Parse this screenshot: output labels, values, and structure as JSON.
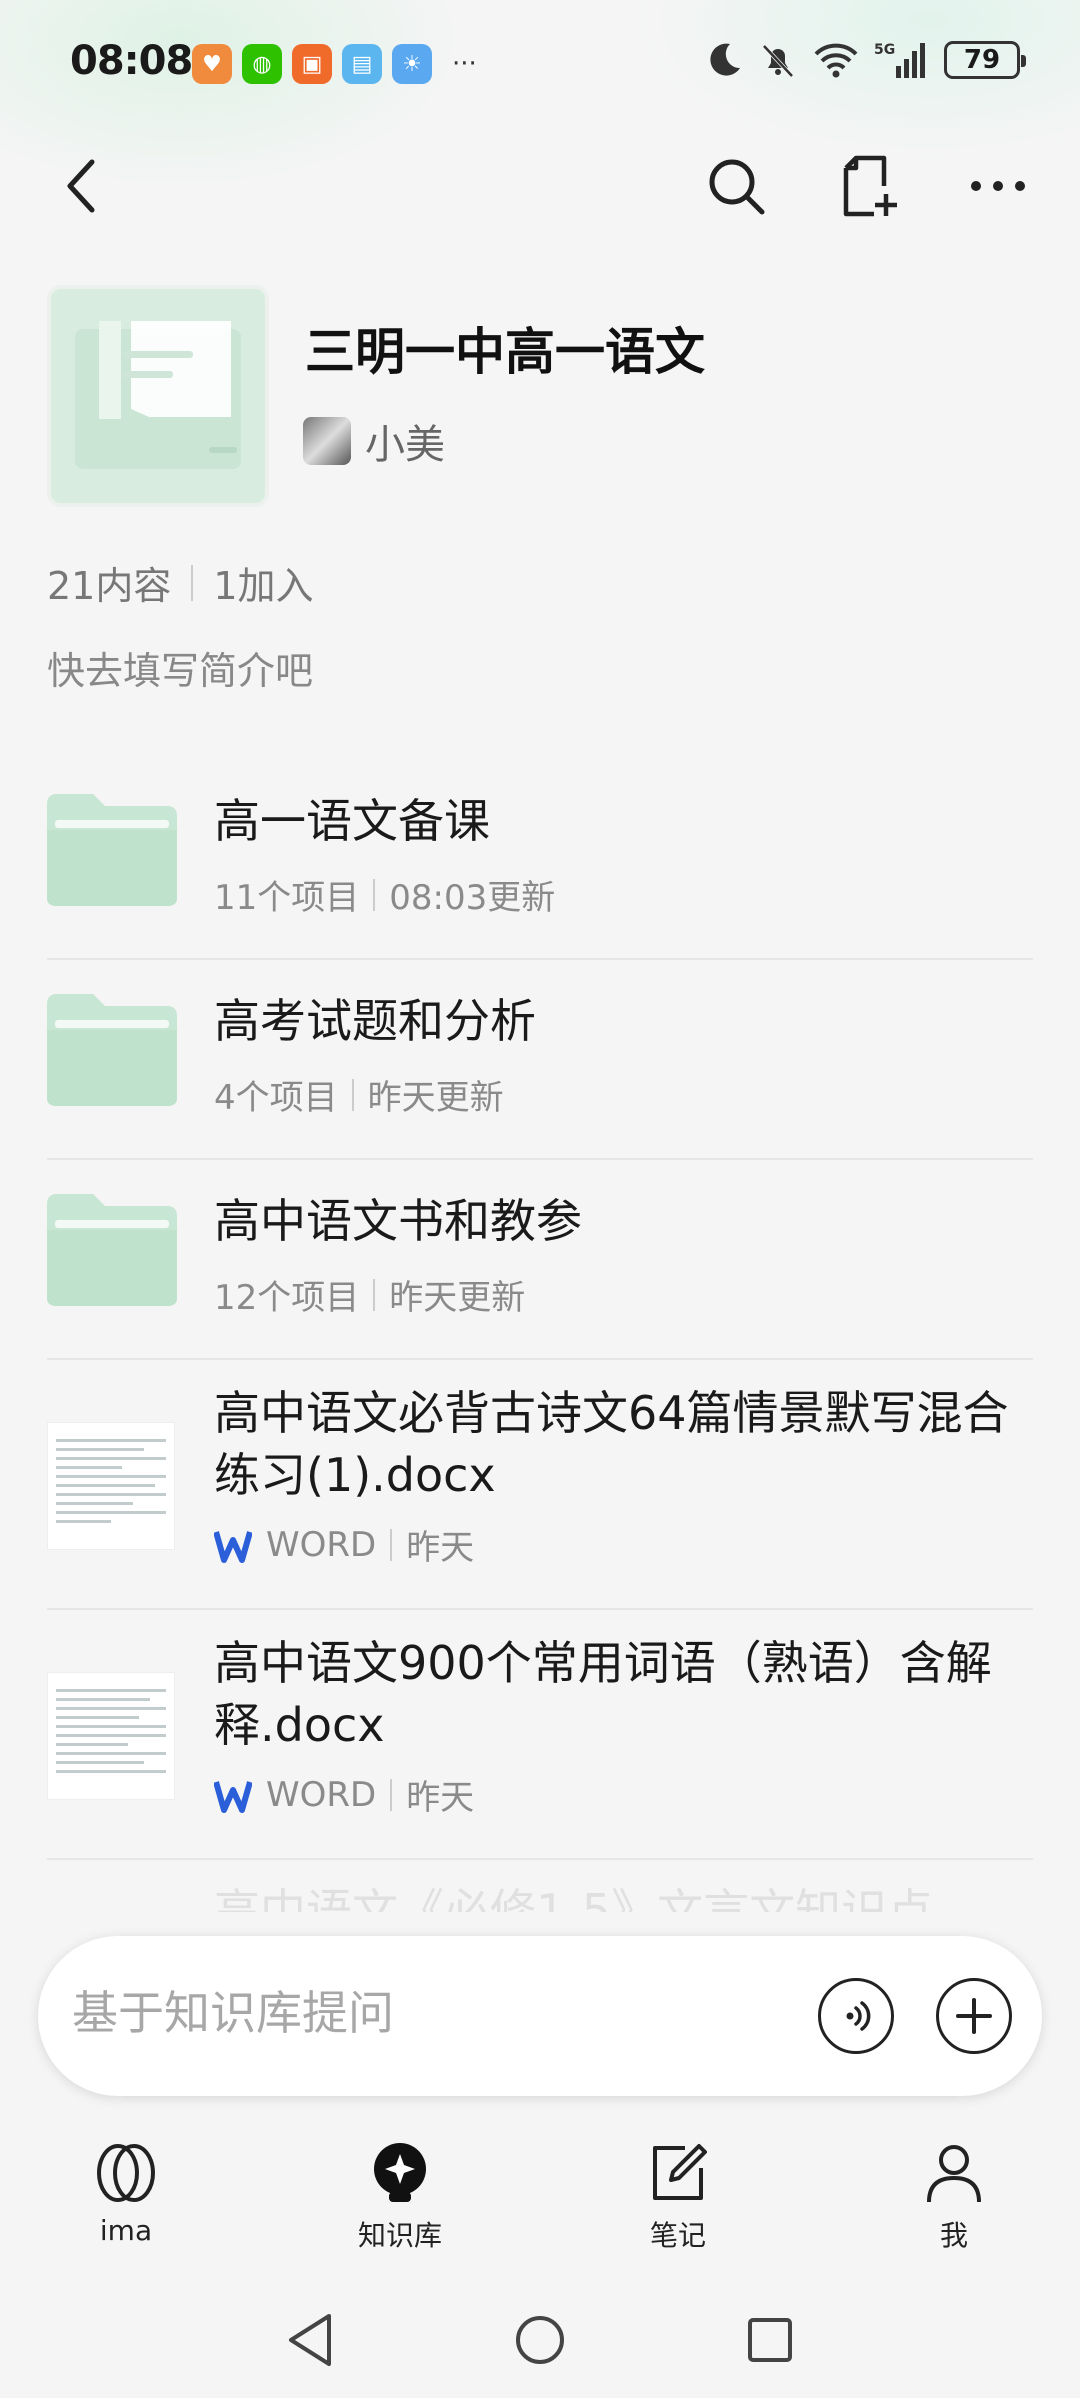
{
  "status_bar": {
    "time": "08:08",
    "battery": "79",
    "signal_label": "5G",
    "overflow": "···"
  },
  "knowledge_base": {
    "title": "三明一中高一语文",
    "owner": "小美",
    "content_count": "21内容",
    "join_count": "1加入",
    "intro_placeholder": "快去填写简介吧"
  },
  "items": [
    {
      "kind": "folder",
      "title": "高一语文备课",
      "count": "11个项目",
      "updated": "08:03更新"
    },
    {
      "kind": "folder",
      "title": "高考试题和分析",
      "count": "4个项目",
      "updated": "昨天更新"
    },
    {
      "kind": "folder",
      "title": "高中语文书和教参",
      "count": "12个项目",
      "updated": "昨天更新"
    },
    {
      "kind": "file",
      "title": "高中语文必背古诗文64篇情景默写混合练习(1).docx",
      "type": "WORD",
      "updated": "昨天"
    },
    {
      "kind": "file",
      "title": "高中语文900个常用词语（熟语）含解释.docx",
      "type": "WORD",
      "updated": "昨天"
    }
  ],
  "partial_item": "高中语文《必修1-5》文言文知识点",
  "ask_bar": {
    "placeholder": "基于知识库提问"
  },
  "tabs": [
    {
      "label": "ima"
    },
    {
      "label": "知识库"
    },
    {
      "label": "笔记"
    },
    {
      "label": "我"
    }
  ],
  "colors": {
    "folder": "#c7e6d3",
    "folder_tab": "#b3dcc3",
    "word_blue": "#2b5fd9"
  }
}
